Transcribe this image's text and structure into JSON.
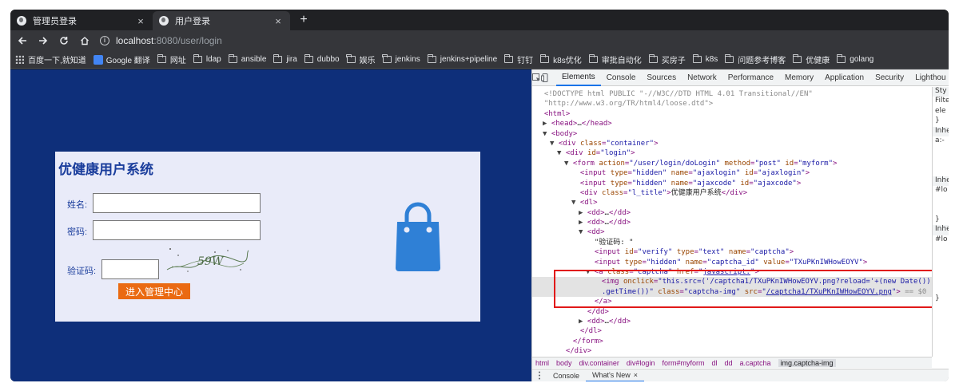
{
  "tabs": [
    {
      "label": "管理员登录",
      "close": "×"
    },
    {
      "label": "用户登录",
      "close": "×"
    }
  ],
  "new_tab": "+",
  "url": {
    "host": "localhost",
    "rest": ":8080/user/login"
  },
  "bookmarks": [
    {
      "label": "百度一下,就知道",
      "icon": "apps-icon"
    },
    {
      "label": "Google 翻译",
      "icon": "google-icon"
    },
    {
      "label": "网址",
      "icon": "folder-icon"
    },
    {
      "label": "ldap",
      "icon": "folder-icon"
    },
    {
      "label": "ansible",
      "icon": "folder-icon"
    },
    {
      "label": "jira",
      "icon": "folder-icon"
    },
    {
      "label": "dubbo",
      "icon": "folder-icon"
    },
    {
      "label": "娱乐",
      "icon": "folder-icon"
    },
    {
      "label": "jenkins",
      "icon": "folder-icon"
    },
    {
      "label": "jenkins+pipeline",
      "icon": "folder-icon"
    },
    {
      "label": "钉钉",
      "icon": "folder-icon"
    },
    {
      "label": "k8s优化",
      "icon": "folder-icon"
    },
    {
      "label": "审批自动化",
      "icon": "folder-icon"
    },
    {
      "label": "买房子",
      "icon": "folder-icon"
    },
    {
      "label": "k8s",
      "icon": "folder-icon"
    },
    {
      "label": "问题参考博客",
      "icon": "folder-icon"
    },
    {
      "label": "优健康",
      "icon": "folder-icon"
    },
    {
      "label": "golang",
      "icon": "folder-icon"
    }
  ],
  "login": {
    "title": "优健康用户系统",
    "name_label": "姓名:",
    "password_label": "密码:",
    "captcha_label": "验证码:",
    "captcha_text": "59W",
    "submit": "进入管理中心"
  },
  "devtools": {
    "tabs": [
      "Elements",
      "Console",
      "Sources",
      "Network",
      "Performance",
      "Memory",
      "Application",
      "Security",
      "Lighthou"
    ],
    "lines": [
      {
        "indent": 0,
        "tri": "",
        "html": "<span class='cmt'>&lt;!DOCTYPE html PUBLIC \"-//W3C//DTD HTML 4.01 Transitional//EN\"</span>"
      },
      {
        "indent": 0,
        "tri": "",
        "html": "<span class='cmt'>\"http://www.w3.org/TR/html4/loose.dtd\"&gt;</span>"
      },
      {
        "indent": 0,
        "tri": "",
        "html": "<span class='tag'>&lt;html&gt;</span>"
      },
      {
        "indent": 1,
        "tri": "▶",
        "html": "<span class='tag'>&lt;head&gt;</span><span class='txt'>…</span><span class='tag'>&lt;/head&gt;</span>"
      },
      {
        "indent": 1,
        "tri": "▼",
        "html": "<span class='tag'>&lt;body&gt;</span>"
      },
      {
        "indent": 2,
        "tri": "▼",
        "html": "<span class='tag'>&lt;div </span><span class='attr'>class</span><span class='tag'>=</span><span class='val'>\"container\"</span><span class='tag'>&gt;</span>"
      },
      {
        "indent": 3,
        "tri": "▼",
        "html": "<span class='tag'>&lt;div </span><span class='attr'>id</span><span class='tag'>=</span><span class='val'>\"login\"</span><span class='tag'>&gt;</span>"
      },
      {
        "indent": 4,
        "tri": "▼",
        "html": "<span class='tag'>&lt;form </span><span class='attr'>action</span><span class='tag'>=</span><span class='val'>\"/user/login/doLogin\"</span><span class='tag'> </span><span class='attr'>method</span><span class='tag'>=</span><span class='val'>\"post\"</span><span class='tag'> </span><span class='attr'>id</span><span class='tag'>=</span><span class='val'>\"myform\"</span><span class='tag'>&gt;</span>"
      },
      {
        "indent": 5,
        "tri": "",
        "html": "<span class='tag'>&lt;input </span><span class='attr'>type</span><span class='tag'>=</span><span class='val'>\"hidden\"</span><span class='tag'> </span><span class='attr'>name</span><span class='tag'>=</span><span class='val'>\"ajaxlogin\"</span><span class='tag'> </span><span class='attr'>id</span><span class='tag'>=</span><span class='val'>\"ajaxlogin\"</span><span class='tag'>&gt;</span>"
      },
      {
        "indent": 5,
        "tri": "",
        "html": "<span class='tag'>&lt;input </span><span class='attr'>type</span><span class='tag'>=</span><span class='val'>\"hidden\"</span><span class='tag'> </span><span class='attr'>name</span><span class='tag'>=</span><span class='val'>\"ajaxcode\"</span><span class='tag'> </span><span class='attr'>id</span><span class='tag'>=</span><span class='val'>\"ajaxcode\"</span><span class='tag'>&gt;</span>"
      },
      {
        "indent": 5,
        "tri": "",
        "html": "<span class='tag'>&lt;div </span><span class='attr'>class</span><span class='tag'>=</span><span class='val'>\"l_title\"</span><span class='tag'>&gt;</span><span class='txt'>优健康用户系统</span><span class='tag'>&lt;/div&gt;</span>"
      },
      {
        "indent": 5,
        "tri": "▼",
        "html": "<span class='tag'>&lt;dl&gt;</span>"
      },
      {
        "indent": 6,
        "tri": "▶",
        "html": "<span class='tag'>&lt;dd&gt;</span><span class='txt'>…</span><span class='tag'>&lt;/dd&gt;</span>"
      },
      {
        "indent": 6,
        "tri": "▶",
        "html": "<span class='tag'>&lt;dd&gt;</span><span class='txt'>…</span><span class='tag'>&lt;/dd&gt;</span>"
      },
      {
        "indent": 6,
        "tri": "▼",
        "html": "<span class='tag'>&lt;dd&gt;</span>"
      },
      {
        "indent": 7,
        "tri": "",
        "html": "<span class='txt'>\"验证码: \"</span>"
      },
      {
        "indent": 7,
        "tri": "",
        "html": "<span class='tag'>&lt;input </span><span class='attr'>id</span><span class='tag'>=</span><span class='val'>\"verify\"</span><span class='tag'> </span><span class='attr'>type</span><span class='tag'>=</span><span class='val'>\"text\"</span><span class='tag'> </span><span class='attr'>name</span><span class='tag'>=</span><span class='val'>\"captcha\"</span><span class='tag'>&gt;</span>"
      },
      {
        "indent": 7,
        "tri": "",
        "html": "<span class='tag'>&lt;input </span><span class='attr'>type</span><span class='tag'>=</span><span class='val'>\"hidden\"</span><span class='tag'> </span><span class='attr'>name</span><span class='tag'>=</span><span class='val'>\"captcha_id\"</span><span class='tag'> </span><span class='attr'>value</span><span class='tag'>=</span><span class='val'>\"TXuPKnIWHowEOYV\"</span><span class='tag'>&gt;</span>"
      },
      {
        "indent": 7,
        "tri": "▼",
        "html": "<span class='tag'>&lt;a </span><span class='attr'>class</span><span class='tag'>=</span><span class='val'>\"captcha\"</span><span class='tag'> </span><span class='attr'>href</span><span class='tag'>=</span><span class='val'>\"</span><span class='link'>javascript:</span><span class='val'>\"</span><span class='tag'>&gt;</span>"
      },
      {
        "indent": 8,
        "tri": "",
        "sel": true,
        "html": "<span class='tag'>&lt;img </span><span class='attr'>onclick</span><span class='tag'>=</span><span class='val'>\"this.src=('/captcha1/TXuPKnIWHowEOYV.png?reload='+(new Date())</span>"
      },
      {
        "indent": 8,
        "tri": "",
        "sel": true,
        "html": "<span class='val'>.getTime())\"</span><span class='tag'> </span><span class='attr'>class</span><span class='tag'>=</span><span class='val'>\"captcha-img\"</span><span class='tag'> </span><span class='attr'>src</span><span class='tag'>=</span><span class='val'>\"</span><span class='link'>/captcha1/TXuPKnIWHowEOYV.png</span><span class='val'>\"</span><span class='tag'>&gt;</span><span class='cmt'> == $0</span>"
      },
      {
        "indent": 7,
        "tri": "",
        "html": "<span class='tag'>&lt;/a&gt;</span>"
      },
      {
        "indent": 6,
        "tri": "",
        "html": "<span class='tag'>&lt;/dd&gt;</span>"
      },
      {
        "indent": 6,
        "tri": "▶",
        "html": "<span class='tag'>&lt;dd&gt;</span><span class='txt'>…</span><span class='tag'>&lt;/dd&gt;</span>"
      },
      {
        "indent": 5,
        "tri": "",
        "html": "<span class='tag'>&lt;/dl&gt;</span>"
      },
      {
        "indent": 4,
        "tri": "",
        "html": "<span class='tag'>&lt;/form&gt;</span>"
      },
      {
        "indent": 3,
        "tri": "",
        "html": "<span class='tag'>&lt;/div&gt;</span>"
      }
    ],
    "styles": [
      "Sty",
      "Filte",
      "ele",
      "}",
      "Inhe",
      "a:-",
      "",
      "",
      "",
      "Inhe",
      "#lo",
      "",
      "",
      "}",
      "Inhe",
      "#lo",
      "",
      "",
      "",
      "",
      "",
      "}"
    ],
    "breadcrumbs": [
      "html",
      "body",
      "div.container",
      "div#login",
      "form#myform",
      "dl",
      "dd",
      "a.captcha",
      "img.captcha-img"
    ],
    "drawer_tabs": [
      "Console",
      "What's New"
    ],
    "drawer_close": "×"
  },
  "colors": {
    "page_bg": "#0e2f7a",
    "login_bg": "#e9ebf9",
    "title": "#1a3d9c",
    "submit_bg": "#ea6a12",
    "bag": "#2f80d6",
    "highlight": "#e11919"
  }
}
